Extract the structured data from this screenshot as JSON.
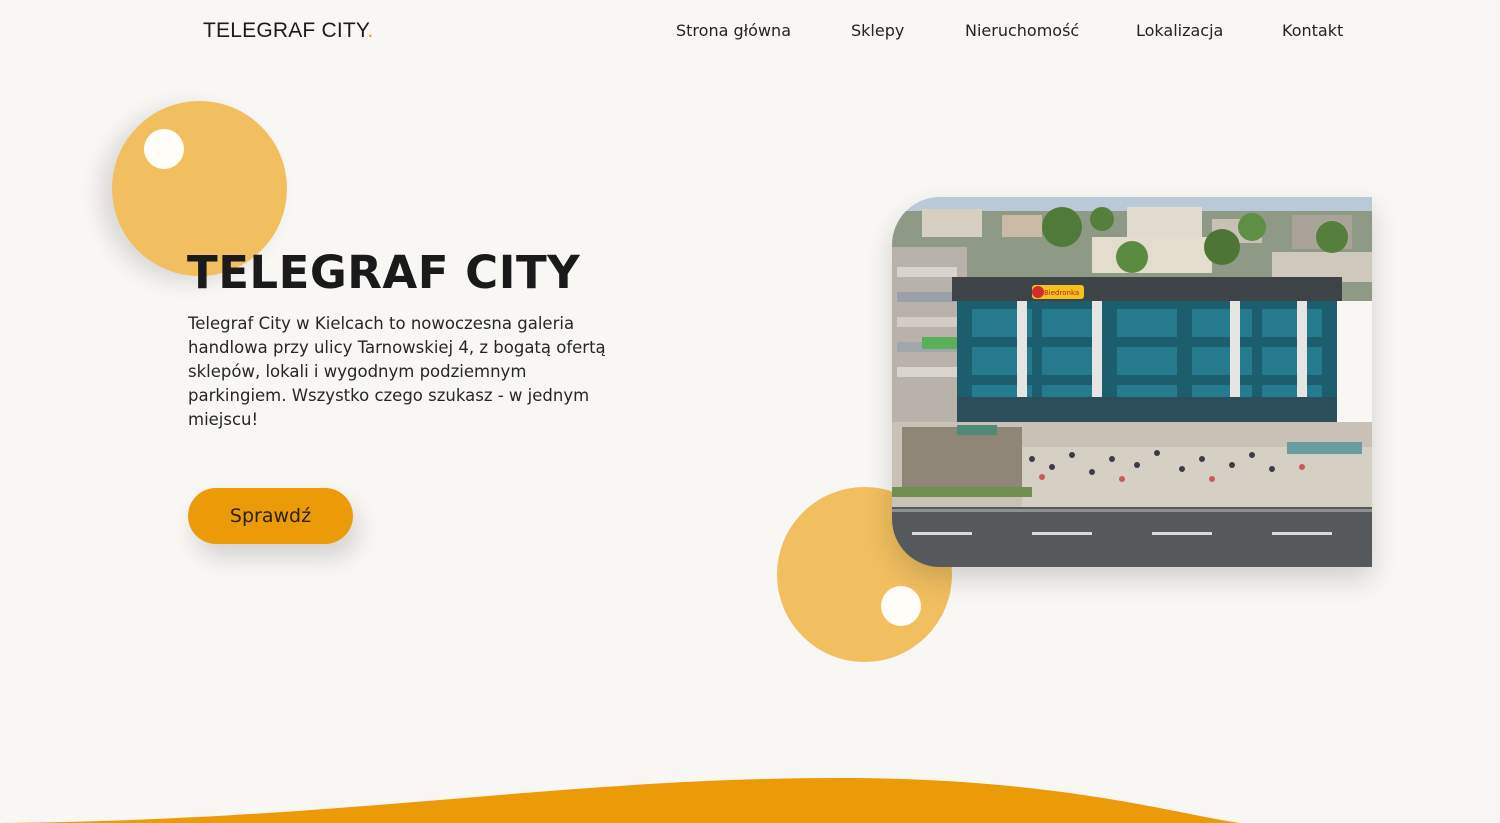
{
  "header": {
    "logo_text": "TELEGRAF CITY",
    "logo_dot": "."
  },
  "nav": {
    "items": [
      {
        "label": "Strona główna"
      },
      {
        "label": "Sklepy"
      },
      {
        "label": "Nieruchomość"
      },
      {
        "label": "Lokalizacja"
      },
      {
        "label": "Kontakt"
      }
    ]
  },
  "hero": {
    "title": "TELEGRAF CITY",
    "description": "Telegraf City w Kielcach to nowoczesna galeria handlowa przy ulicy Tarnowskiej 4, z bogatą ofertą sklepów, lokali i wygodnym podziemnym parkingiem. Wszystko czego szukasz - w jednym miejscu!",
    "cta_label": "Sprawdź"
  },
  "photo": {
    "store_sign": "Biedronka"
  },
  "colors": {
    "background": "#f8f7f4",
    "accent": "#eb9b08",
    "circle": "#f1bf60"
  }
}
